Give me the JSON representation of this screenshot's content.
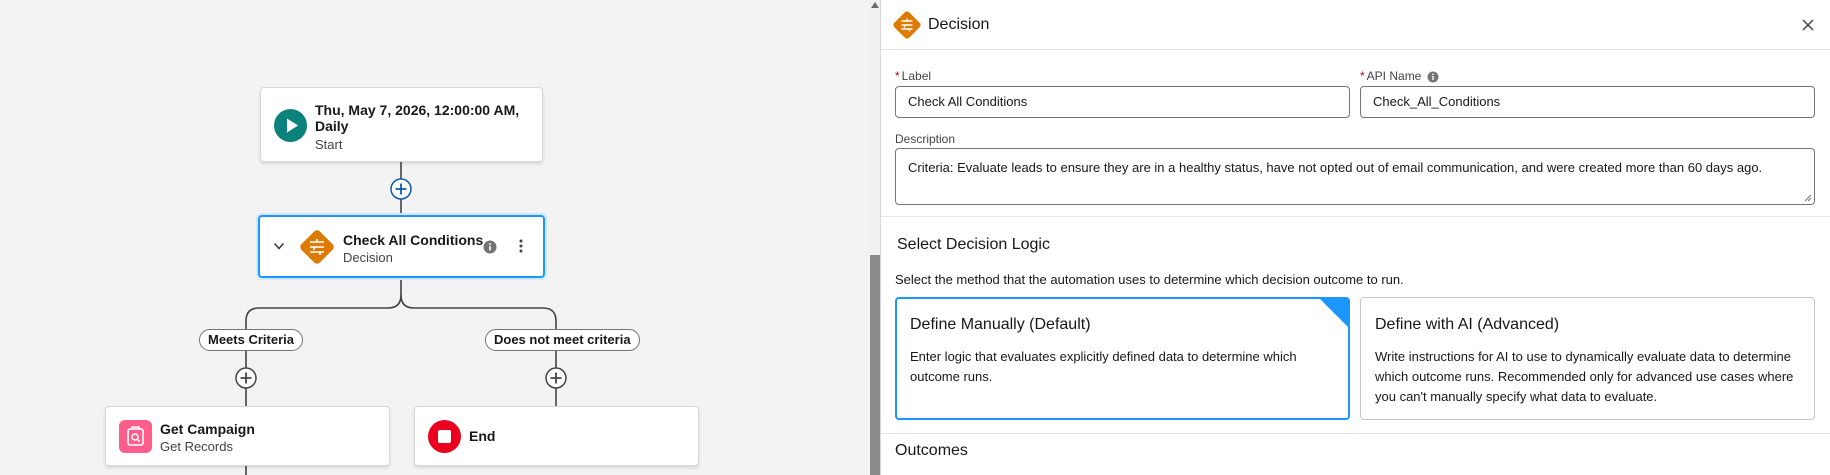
{
  "canvas": {
    "start_node": {
      "title": "Thu, May 7, 2026, 12:00:00 AM, Daily",
      "subtitle": "Start"
    },
    "decision_node": {
      "title": "Check All Conditions",
      "subtitle": "Decision"
    },
    "branches": {
      "left": "Meets Criteria",
      "right": "Does not meet criteria"
    },
    "get_campaign_node": {
      "title": "Get Campaign",
      "subtitle": "Get Records"
    },
    "end_node": {
      "title": "End"
    }
  },
  "panel": {
    "title": "Decision",
    "label_field": {
      "label": "Label",
      "required_mark": "*",
      "value": "Check All Conditions"
    },
    "api_field": {
      "label": "API Name",
      "required_mark": "*",
      "value": "Check_All_Conditions"
    },
    "description_field": {
      "label": "Description",
      "value": "Criteria: Evaluate leads to ensure they are in a healthy status, have not opted out of email communication, and were created more than 60 days ago."
    },
    "decision_logic": {
      "heading": "Select Decision Logic",
      "description": "Select the method that the automation uses to determine which decision outcome to run.",
      "options": [
        {
          "title": "Define Manually (Default)",
          "description": "Enter logic that evaluates explicitly defined data to determine which outcome runs.",
          "selected": true
        },
        {
          "title": "Define with AI (Advanced)",
          "description": "Write instructions for AI to use to dynamically evaluate data to determine which outcome runs. Recommended only for advanced use cases where you can't manually specify what data to evaluate.",
          "selected": false
        }
      ]
    },
    "outcomes_heading": "Outcomes"
  },
  "icons": {
    "start": "play-icon",
    "decision": "decision-diamond-icon",
    "get_records": "get-records-icon",
    "end": "stop-icon",
    "add": "add-circle-icon",
    "info": "info-icon",
    "more": "more-vertical-icon",
    "collapse": "chevron-down-icon",
    "close": "close-icon"
  },
  "colors": {
    "start": "#0b827c",
    "decision": "#dd7a01",
    "get_records": "#ff5d8b",
    "end": "#ea001e",
    "selection": "#1b96ff",
    "connector": "#444444"
  }
}
